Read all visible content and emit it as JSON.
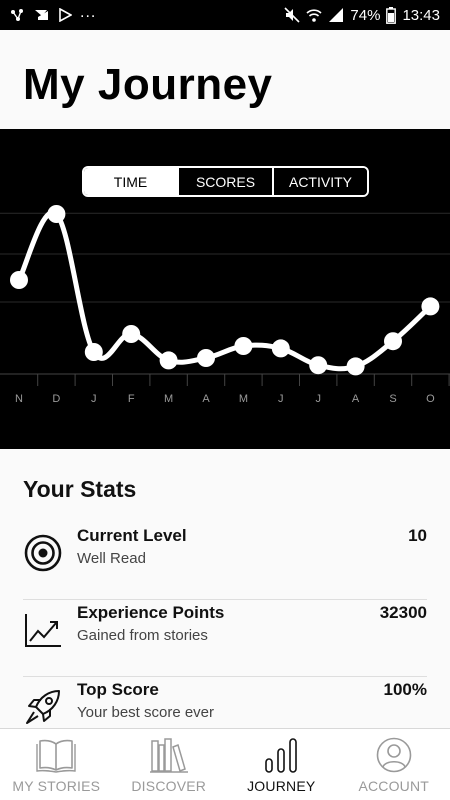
{
  "status_bar": {
    "battery": "74%",
    "time": "13:43",
    "icons": [
      "bluetooth-dots-icon",
      "screen-mirror-icon",
      "play-store-icon",
      "mute-icon",
      "wifi-icon",
      "signal-icon",
      "battery-icon"
    ],
    "overflow": "..."
  },
  "header": {
    "title": "My Journey"
  },
  "chart": {
    "tabs": [
      {
        "label": "TIME",
        "active": true
      },
      {
        "label": "SCORES",
        "active": false
      },
      {
        "label": "ACTIVITY",
        "active": false
      }
    ]
  },
  "chart_data": {
    "type": "line",
    "categories": [
      "N",
      "D",
      "J",
      "F",
      "M",
      "A",
      "M",
      "J",
      "J",
      "A",
      "S",
      "O"
    ],
    "values": [
      7.5,
      13,
      1.5,
      3,
      0.8,
      1,
      2,
      1.8,
      0.4,
      0.3,
      2.4,
      5.3
    ],
    "ylim": [
      0,
      20
    ],
    "grid": true,
    "line_color": "#ffffff",
    "background": "#000000"
  },
  "stats": {
    "heading": "Your Stats",
    "items": [
      {
        "icon": "target-icon",
        "title": "Current Level",
        "subtitle": "Well Read",
        "value": "10"
      },
      {
        "icon": "trend-chart-icon",
        "title": "Experience Points",
        "subtitle": "Gained from stories",
        "value": "32300"
      },
      {
        "icon": "rocket-icon",
        "title": "Top Score",
        "subtitle": "Your best score ever",
        "value": "100%"
      }
    ]
  },
  "nav": {
    "items": [
      {
        "label": "MY STORIES",
        "icon": "open-book-icon",
        "active": false
      },
      {
        "label": "DISCOVER",
        "icon": "bookshelf-icon",
        "active": false
      },
      {
        "label": "JOURNEY",
        "icon": "bars-icon",
        "active": true
      },
      {
        "label": "ACCOUNT",
        "icon": "user-icon",
        "active": false
      }
    ]
  }
}
